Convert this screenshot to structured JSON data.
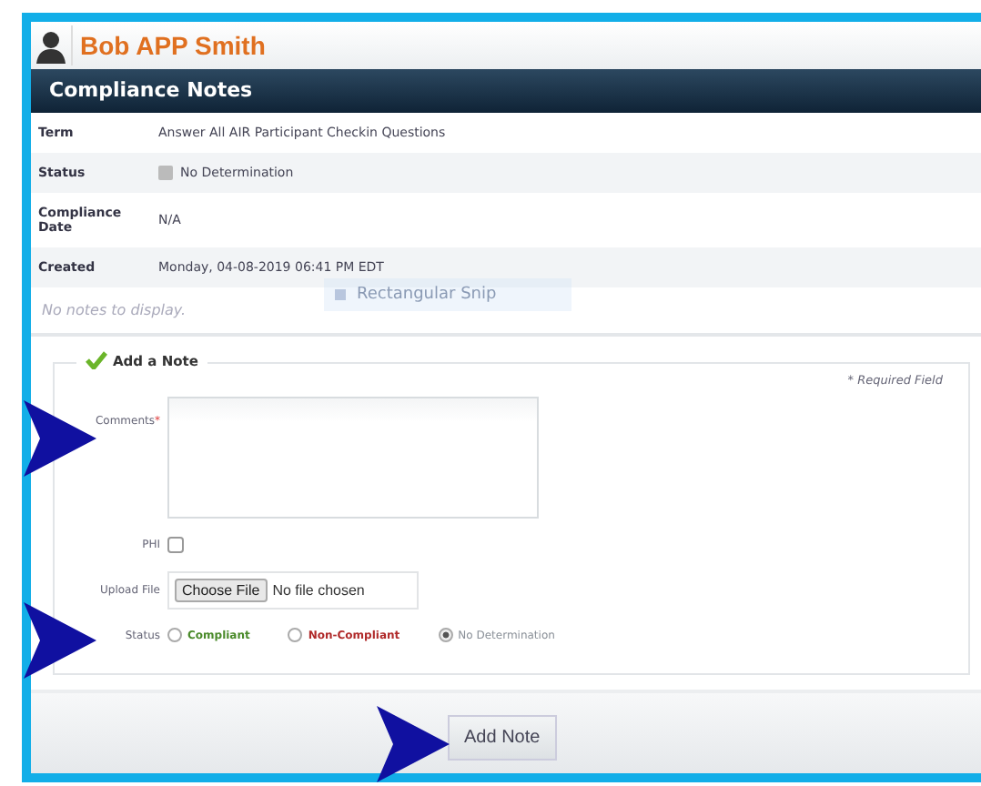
{
  "header": {
    "name": "Bob APP Smith"
  },
  "panel": {
    "title": "Compliance Notes"
  },
  "details": [
    {
      "label": "Term",
      "value": "Answer All AIR Participant Checkin Questions"
    },
    {
      "label": "Status",
      "value": "No Determination",
      "kind": "status"
    },
    {
      "label": "Compliance Date",
      "value": "N/A"
    },
    {
      "label": "Created",
      "value": "Monday, 04-08-2019 06:41 PM EDT"
    }
  ],
  "empty_message": "No notes to display.",
  "snip_overlay": {
    "label": "Rectangular Snip"
  },
  "form": {
    "legend": "Add a Note",
    "required_note": "* Required Field",
    "comments": {
      "label": "Comments",
      "required_mark": "*"
    },
    "phi": {
      "label": "PHI",
      "checked": false
    },
    "upload": {
      "label": "Upload File",
      "button": "Choose File",
      "status": "No file chosen"
    },
    "status": {
      "label": "Status",
      "options": [
        {
          "label": "Compliant",
          "color": "#4a8a2a",
          "selected": false
        },
        {
          "label": "Non-Compliant",
          "color": "#b02a2a",
          "selected": false
        },
        {
          "label": "No Determination",
          "color": "#8a9098",
          "selected": true
        }
      ]
    }
  },
  "submit": "Add Note"
}
